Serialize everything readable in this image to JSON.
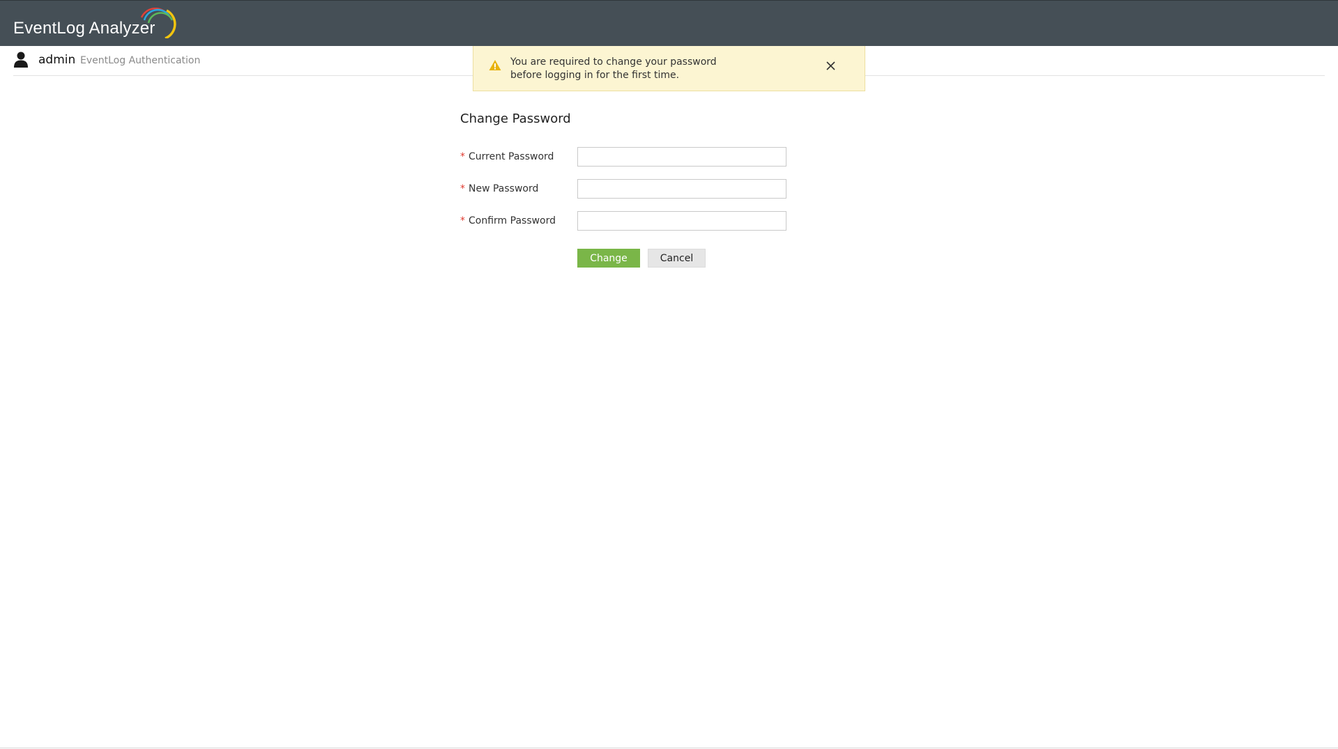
{
  "header": {
    "app_title": "EventLog Analyzer",
    "logo_icon": "eventlog-analyzer-arcs-logo"
  },
  "userbar": {
    "user_icon": "user-icon",
    "username": "admin",
    "auth_label": "EventLog Authentication"
  },
  "alert": {
    "icon": "warning-icon",
    "message_line1": "You are required to change your password",
    "message_line2": "before logging in for the first time.",
    "close_icon": "close-icon"
  },
  "form": {
    "title": "Change Password",
    "required_marker": "*",
    "fields": [
      {
        "label": "Current Password",
        "value": ""
      },
      {
        "label": "New Password",
        "value": ""
      },
      {
        "label": "Confirm Password",
        "value": ""
      }
    ],
    "change_label": "Change",
    "cancel_label": "Cancel"
  },
  "colors": {
    "topbar": "#454f56",
    "alert_bg": "#fcf5d2",
    "change_button": "#7ab648",
    "required_marker": "#e03c31",
    "warning_icon": "#e8b30d"
  }
}
